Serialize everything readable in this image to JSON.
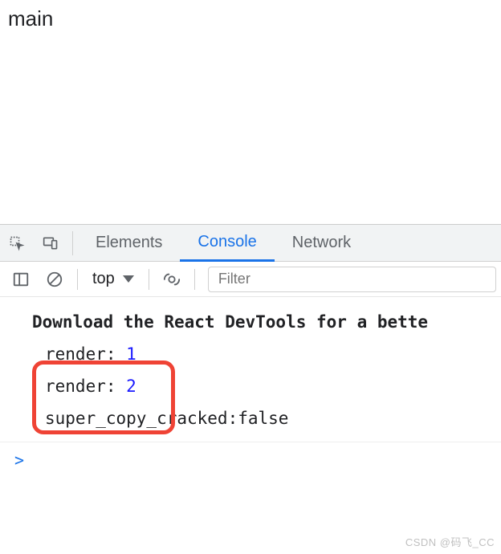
{
  "page": {
    "content": "main"
  },
  "tabs": {
    "elements": "Elements",
    "console": "Console",
    "network": "Network",
    "active": "console"
  },
  "toolbar": {
    "context": "top",
    "filter_placeholder": "Filter"
  },
  "logs": {
    "r0": "Download the React DevTools for a bette",
    "r1a": "render: ",
    "r1b": "1",
    "r2a": "render: ",
    "r2b": "2",
    "r3": "super_copy_cracked:false"
  },
  "prompt": ">",
  "watermark": "CSDN @码飞_CC"
}
